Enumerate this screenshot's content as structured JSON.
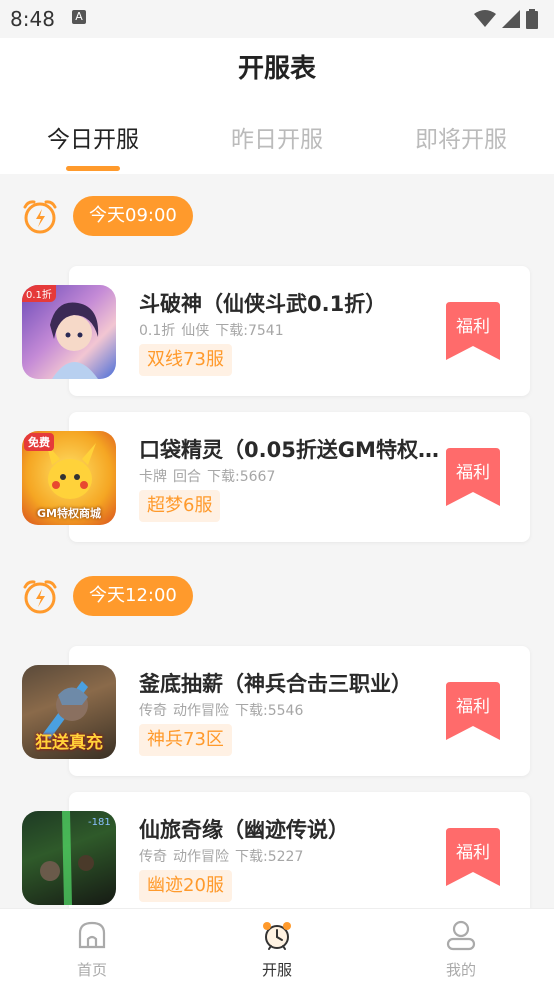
{
  "status_bar": {
    "time": "8:48",
    "notification_glyph": "A"
  },
  "header": {
    "title": "开服表"
  },
  "tabs": [
    {
      "label": "今日开服",
      "active": true
    },
    {
      "label": "昨日开服",
      "active": false
    },
    {
      "label": "即将开服",
      "active": false
    }
  ],
  "groups": [
    {
      "time": "今天09:00",
      "games": [
        {
          "title": "斗破神（仙侠斗武0.1折）",
          "meta": [
            "0.1折",
            "仙侠",
            "下载:7541"
          ],
          "server": "双线73服",
          "badge": "福利",
          "thumb_badge": "0.1折"
        },
        {
          "title": "口袋精灵（0.05折送GM特权…",
          "meta": [
            "卡牌",
            "回合",
            "下载:5667"
          ],
          "server": "超梦6服",
          "badge": "福利",
          "thumb_badge": "免费",
          "thumb_text": "GM特权商城"
        }
      ]
    },
    {
      "time": "今天12:00",
      "games": [
        {
          "title": "釜底抽薪（神兵合击三职业）",
          "meta": [
            "传奇",
            "动作冒险",
            "下载:5546"
          ],
          "server": "神兵73区",
          "badge": "福利",
          "thumb_text": "狂送真充"
        },
        {
          "title": "仙旅奇缘（幽迹传说）",
          "meta": [
            "传奇",
            "动作冒险",
            "下载:5227"
          ],
          "server": "幽迹20服",
          "badge": "福利"
        }
      ]
    }
  ],
  "bottom_nav": [
    {
      "label": "首页",
      "icon": "home-icon",
      "active": false
    },
    {
      "label": "开服",
      "icon": "alarm-clock-icon",
      "active": true
    },
    {
      "label": "我的",
      "icon": "profile-icon",
      "active": false
    }
  ],
  "colors": {
    "accent": "#ff9a2c",
    "badge": "#ff6b6b",
    "tag_bg": "#fff1e4"
  }
}
